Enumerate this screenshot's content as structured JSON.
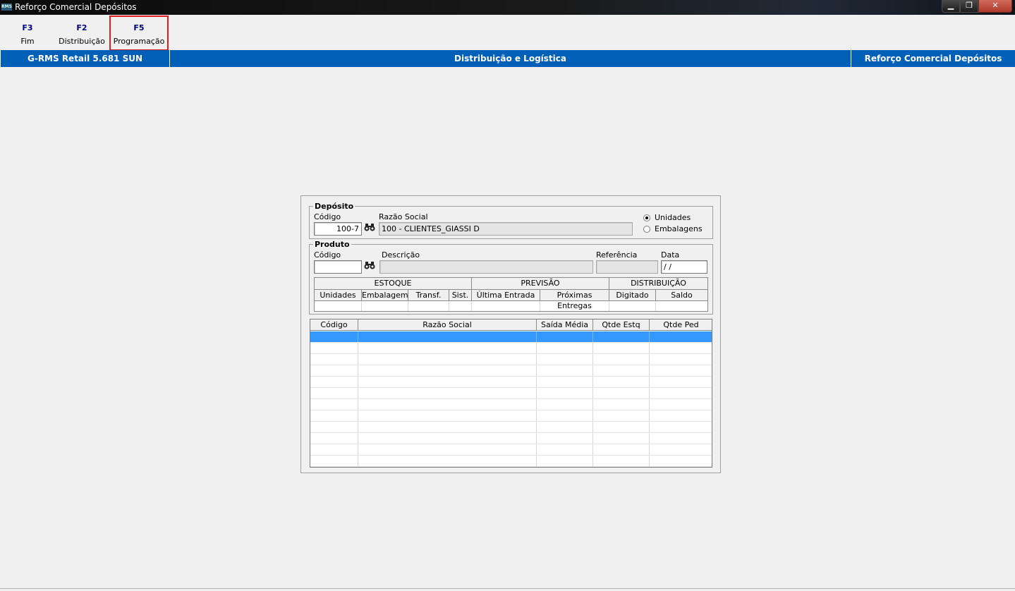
{
  "window": {
    "title": "Reforço Comercial Depósitos",
    "app_icon_text": "RMS",
    "min_glyph": "▁",
    "max_glyph": "❐",
    "close_glyph": "✕"
  },
  "toolbar": {
    "buttons": [
      {
        "key": "F3",
        "label": "Fim"
      },
      {
        "key": "F2",
        "label": "Distribuição"
      },
      {
        "key": "F5",
        "label": "Programação"
      }
    ]
  },
  "header_band": {
    "system": "G-RMS Retail 5.681  SUN",
    "module": "Distribuição e Logística",
    "screen": "Reforço Comercial Depósitos"
  },
  "deposito": {
    "legend": "Depósito",
    "codigo_label": "Código",
    "codigo_value": "100-7",
    "razao_label": "Razão Social",
    "razao_value": "100 - CLIENTES_GIASSI D",
    "radio_unidades": "Unidades",
    "radio_embalagens": "Embalagens",
    "selected": "Unidades"
  },
  "produto": {
    "legend": "Produto",
    "codigo_label": "Código",
    "codigo_value": "",
    "descricao_label": "Descrição",
    "descricao_value": "",
    "referencia_label": "Referência",
    "referencia_value": "",
    "data_label": "Data",
    "data_value": " /  /",
    "groups": [
      "ESTOQUE",
      "PREVISÃO",
      "DISTRIBUIÇÃO"
    ],
    "columns": [
      "Unidades",
      "Embalagem",
      "Transf.",
      "Sist.",
      "Última Entrada",
      "Próximas Entregas",
      "Digitado",
      "Saldo"
    ]
  },
  "results": {
    "columns": [
      "Código",
      "Razão Social",
      "Saída Média",
      "Qtde Estq",
      "Qtde Ped"
    ]
  },
  "icons": {
    "binoculars": "binoculars-icon"
  }
}
